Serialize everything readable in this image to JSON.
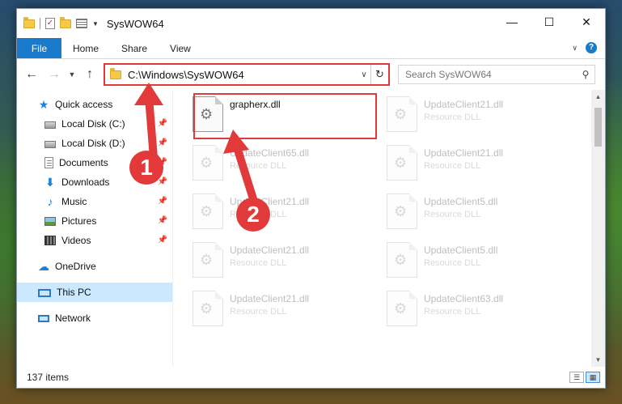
{
  "window": {
    "title": "SysWOW64",
    "controls": {
      "minimize": "—",
      "maximize": "☐",
      "close": "✕"
    }
  },
  "ribbon": {
    "tabs": [
      "File",
      "Home",
      "Share",
      "View"
    ]
  },
  "address": {
    "path": "C:\\Windows\\SysWOW64",
    "search_placeholder": "Search SysWOW64"
  },
  "nav": {
    "items": [
      {
        "label": "Quick access",
        "icon": "star-icon",
        "level": 1
      },
      {
        "label": "Local Disk (C:)",
        "icon": "disk-icon",
        "level": 2,
        "pinned": true
      },
      {
        "label": "Local Disk (D:)",
        "icon": "disk-icon",
        "level": 2,
        "pinned": true
      },
      {
        "label": "Documents",
        "icon": "documents-icon",
        "level": 2,
        "pinned": true
      },
      {
        "label": "Downloads",
        "icon": "downloads-icon",
        "level": 2,
        "pinned": true
      },
      {
        "label": "Music",
        "icon": "music-icon",
        "level": 2,
        "pinned": true
      },
      {
        "label": "Pictures",
        "icon": "pictures-icon",
        "level": 2,
        "pinned": true
      },
      {
        "label": "Videos",
        "icon": "videos-icon",
        "level": 2,
        "pinned": true
      },
      {
        "label": "OneDrive",
        "icon": "onedrive-icon",
        "level": 1
      },
      {
        "label": "This PC",
        "icon": "this-pc-icon",
        "level": 1,
        "selected": true
      },
      {
        "label": "Network",
        "icon": "network-icon",
        "level": 1
      }
    ]
  },
  "files": [
    {
      "name": "grapherx.dll",
      "type": "",
      "active": true
    },
    {
      "name": "UpdateClient21.dll",
      "type": "Resource DLL"
    },
    {
      "name": "UpdateClient65.dll",
      "type": "Resource DLL"
    },
    {
      "name": "UpdateClient21.dll",
      "type": "Resource DLL"
    },
    {
      "name": "UpdateClient21.dll",
      "type": "Resource DLL"
    },
    {
      "name": "UpdateClient5.dll",
      "type": "Resource DLL"
    },
    {
      "name": "UpdateClient21.dll",
      "type": "Resource DLL"
    },
    {
      "name": "UpdateClient5.dll",
      "type": "Resource DLL"
    },
    {
      "name": "UpdateClient21.dll",
      "type": "Resource DLL"
    },
    {
      "name": "UpdateClient63.dll",
      "type": "Resource DLL"
    }
  ],
  "status": {
    "item_count": "137 items"
  },
  "annotations": {
    "step1": "1",
    "step2": "2",
    "color": "#e23a3a"
  }
}
